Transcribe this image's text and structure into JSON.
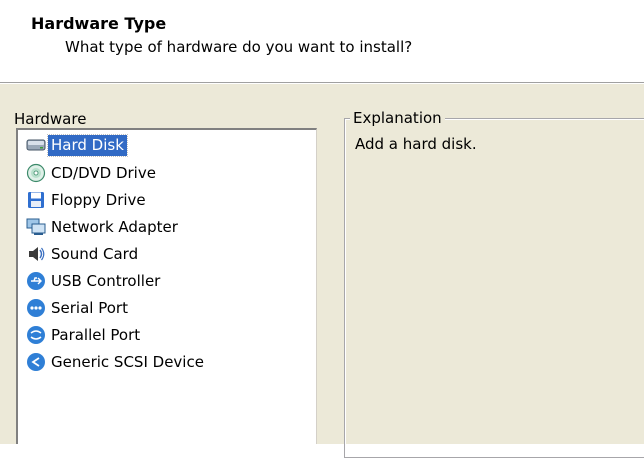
{
  "header": {
    "title": "Hardware Type",
    "subtitle": "What type of hardware do you want to install?"
  },
  "hardware": {
    "label": "Hardware",
    "selected_index": 0,
    "items": [
      {
        "label": "Hard Disk",
        "icon": "hard-disk-icon"
      },
      {
        "label": "CD/DVD Drive",
        "icon": "cd-dvd-icon"
      },
      {
        "label": "Floppy Drive",
        "icon": "floppy-icon"
      },
      {
        "label": "Network Adapter",
        "icon": "network-adapter-icon"
      },
      {
        "label": "Sound Card",
        "icon": "sound-card-icon"
      },
      {
        "label": "USB Controller",
        "icon": "usb-icon"
      },
      {
        "label": "Serial Port",
        "icon": "serial-port-icon"
      },
      {
        "label": "Parallel Port",
        "icon": "parallel-port-icon"
      },
      {
        "label": "Generic SCSI Device",
        "icon": "scsi-icon"
      }
    ]
  },
  "explanation": {
    "legend": "Explanation",
    "text": "Add a hard disk."
  },
  "colors": {
    "panel_bg": "#ece9d8",
    "selection_bg": "#316ac5",
    "icon_blue": "#2f7fd6"
  }
}
